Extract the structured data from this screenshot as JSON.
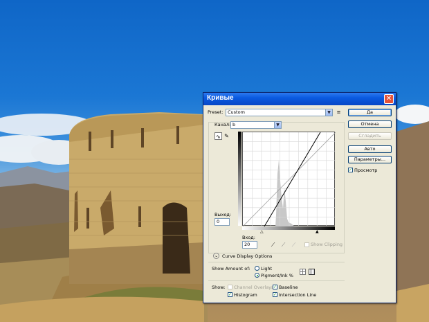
{
  "dialog": {
    "title": "Кривые",
    "preset_label": "Preset:",
    "preset_value": "Custom",
    "channel_label": "Канал:",
    "channel_value": "b",
    "output_label": "Выход:",
    "output_value": "0",
    "input_label": "Вход:",
    "input_value": "20",
    "show_clipping_label": "Show Clipping",
    "curve_display_options_label": "Curve Display Options",
    "show_amount_label": "Show Amount of:",
    "light_label": "Light",
    "pigment_label": "Pigment/Ink %",
    "show_label": "Show:",
    "channel_overlays_label": "Channel Overlays",
    "baseline_label": "Baseline",
    "histogram_label": "Histogram",
    "intersection_line_label": "Intersection Line",
    "preview_label": "Просмотр"
  },
  "buttons": {
    "ok": "Да",
    "cancel": "Отмена",
    "smooth": "Сгладить",
    "auto": "Авто",
    "options": "Параметры..."
  },
  "state": {
    "preview_checked": true,
    "show_clipping_checked": false,
    "channel_overlays_checked": false,
    "baseline_checked": true,
    "histogram_checked": true,
    "intersection_line_checked": true,
    "show_amount": "Pigment/Ink %",
    "curve_points": [
      [
        20,
        0
      ],
      [
        255,
        255
      ]
    ]
  },
  "icons": {
    "close": "close-icon",
    "preset_menu": "preset-menu-icon",
    "curve_tool": "curve-point-tool-icon",
    "pencil_tool": "pencil-tool-icon",
    "black_eyedropper": "black-eyedropper-icon",
    "gray_eyedropper": "gray-eyedropper-icon",
    "white_eyedropper": "white-eyedropper-icon",
    "disclosure": "chevron-down-icon",
    "grid_simple": "grid-4x4-icon",
    "grid_detailed": "grid-10x10-icon"
  },
  "colors": {
    "titlebar": "#0747c6",
    "dialog_bg": "#ece9d8",
    "close": "#e4543a"
  }
}
